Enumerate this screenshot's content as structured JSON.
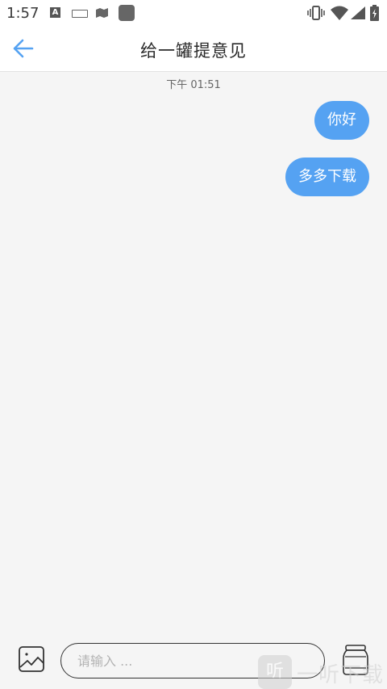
{
  "status_bar": {
    "time": "1:57",
    "icons": [
      "notification-a-icon",
      "keyboard-icon",
      "map-icon",
      "app-square-icon",
      "vibrate-icon",
      "wifi-icon",
      "signal-icon",
      "battery-charging-icon"
    ]
  },
  "header": {
    "title": "给一罐提意见",
    "back_icon": "arrow-left-icon"
  },
  "chat": {
    "timestamp": "下午 01:51",
    "messages": [
      {
        "text": "你好",
        "sender": "self"
      },
      {
        "text": "多多下载",
        "sender": "self"
      }
    ]
  },
  "composer": {
    "input_placeholder": "请输入 ...",
    "input_value": "",
    "image_icon": "image-icon",
    "send_icon": "jar-icon"
  },
  "watermark": {
    "logo_text": "听",
    "text": "一听下载"
  },
  "colors": {
    "accent": "#55a2f2",
    "background": "#f5f5f5",
    "header_bg": "#ffffff"
  }
}
